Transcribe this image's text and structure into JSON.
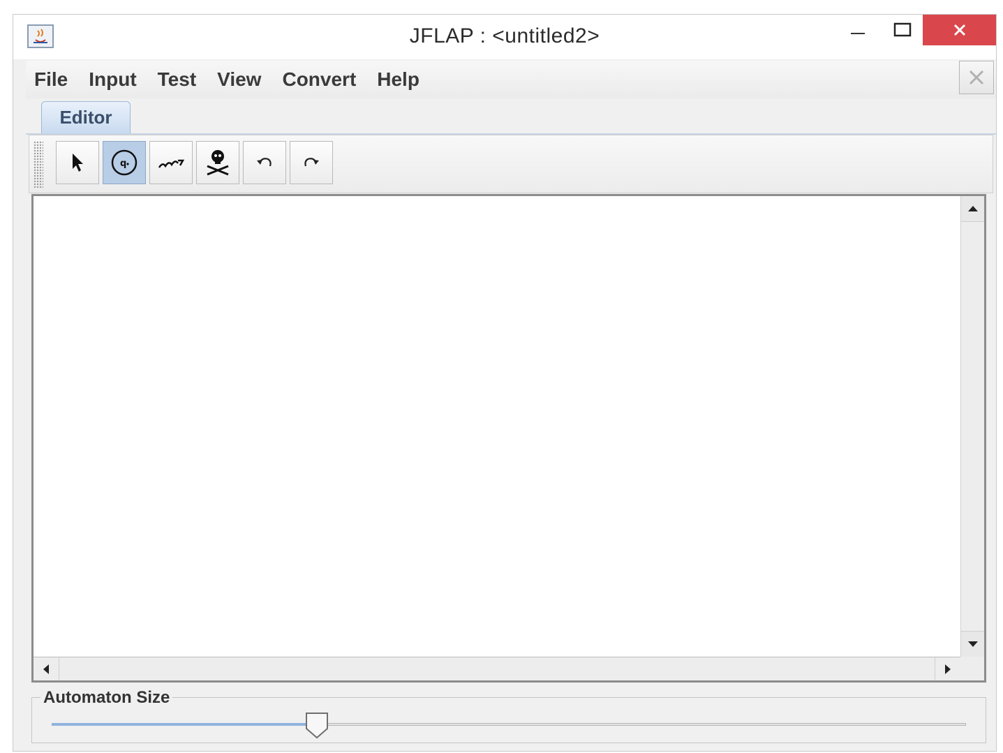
{
  "window": {
    "title": "JFLAP : <untitled2>",
    "close_color": "#d9474d"
  },
  "menu": {
    "items": [
      "File",
      "Input",
      "Test",
      "View",
      "Convert",
      "Help"
    ]
  },
  "tabs": [
    {
      "label": "Editor",
      "selected": true
    }
  ],
  "toolbar": {
    "tools": [
      {
        "icon": "attribute-editor-arrow-icon",
        "selected": false
      },
      {
        "icon": "state-creator-icon",
        "selected": true
      },
      {
        "icon": "transition-creator-icon",
        "selected": false
      },
      {
        "icon": "deleter-icon",
        "selected": false
      },
      {
        "icon": "undo-icon",
        "selected": false
      },
      {
        "icon": "redo-icon",
        "selected": false
      }
    ]
  },
  "automaton_size": {
    "label": "Automaton Size",
    "value_fraction": 0.29
  }
}
